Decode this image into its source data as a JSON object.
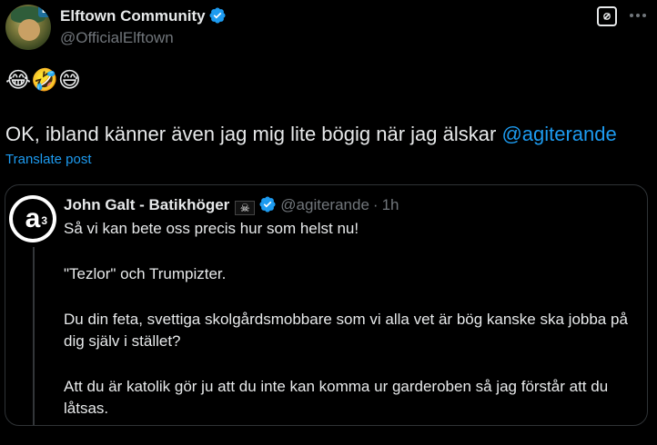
{
  "author": {
    "display_name": "Elftown Community",
    "handle": "@OfficialElftown",
    "avatar_badge": "L",
    "verified": true,
    "verified_color": "#1d9bf0"
  },
  "actions": {
    "grok_icon": "grok-icon",
    "more_icon": "more-icon"
  },
  "post": {
    "emojis": "😂🤣😅",
    "text_before": "OK, ibland känner även jag mig lite bögig när jag älskar ",
    "mention": "@agiterande",
    "translate_label": "Translate post"
  },
  "quote": {
    "avatar_text": "a",
    "avatar_sup": "3",
    "name": "John Galt - Batikhöger",
    "flag": "☠",
    "handle": "@agiterande",
    "dot": "·",
    "time": "1h",
    "lines": [
      "Så vi kan bete oss precis hur som helst nu!",
      "\"Tezlor\" och Trumpizter.",
      "Du din feta, svettiga skolgårdsmobbare som vi alla vet är bög kanske ska jobba på dig själv i stället?",
      "Att du är katolik gör ju att du inte kan komma ur garderoben så jag förstår att du låtsas."
    ]
  },
  "colors": {
    "background": "#000000",
    "text": "#e7e9ea",
    "secondary": "#71767b",
    "accent": "#1d9bf0",
    "border": "#2f3336"
  }
}
